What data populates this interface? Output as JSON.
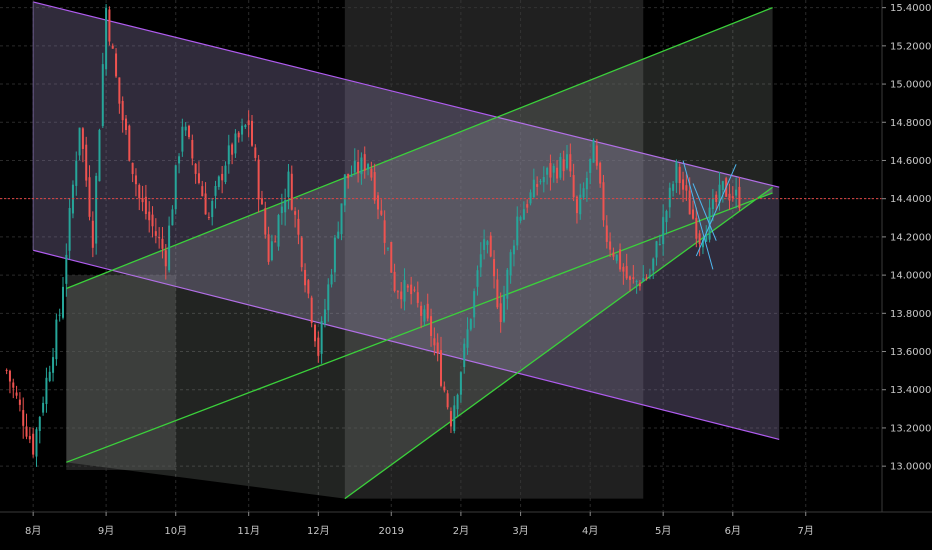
{
  "chart_data": {
    "type": "candlestick",
    "y_ticks": [
      "15.40000",
      "15.20000",
      "15.00000",
      "14.80000",
      "14.60000",
      "14.40000",
      "14.20000",
      "14.00000",
      "13.80000",
      "13.60000",
      "13.40000",
      "13.20000",
      "13.00000"
    ],
    "y_values": [
      15.4,
      15.2,
      15.0,
      14.8,
      14.6,
      14.4,
      14.2,
      14.0,
      13.8,
      13.6,
      13.4,
      13.2,
      13.0
    ],
    "ylim": [
      12.76,
      15.44
    ],
    "x_ticks": [
      "8月",
      "9月",
      "10月",
      "11月",
      "12月",
      "2019",
      "2月",
      "3月",
      "4月",
      "5月",
      "6月",
      "7月"
    ],
    "x_tick_indices": [
      0,
      22,
      43,
      65,
      86,
      108,
      129,
      147,
      168,
      190,
      211,
      233
    ],
    "x_range_index": [
      -10,
      256
    ],
    "current_price": 14.4,
    "key_closes": [
      {
        "index": -8,
        "close": 13.5
      },
      {
        "index": 0,
        "close": 13.1
      },
      {
        "index": 8,
        "close": 13.8
      },
      {
        "index": 14,
        "close": 14.8
      },
      {
        "index": 18,
        "close": 14.2
      },
      {
        "index": 22,
        "close": 15.4
      },
      {
        "index": 26,
        "close": 14.9
      },
      {
        "index": 32,
        "close": 14.4
      },
      {
        "index": 40,
        "close": 14.1
      },
      {
        "index": 45,
        "close": 14.8
      },
      {
        "index": 53,
        "close": 14.3
      },
      {
        "index": 58,
        "close": 14.6
      },
      {
        "index": 65,
        "close": 14.8
      },
      {
        "index": 71,
        "close": 14.1
      },
      {
        "index": 77,
        "close": 14.5
      },
      {
        "index": 86,
        "close": 13.6
      },
      {
        "index": 94,
        "close": 14.5
      },
      {
        "index": 101,
        "close": 14.6
      },
      {
        "index": 105,
        "close": 14.3
      },
      {
        "index": 109,
        "close": 13.95
      },
      {
        "index": 114,
        "close": 13.9
      },
      {
        "index": 120,
        "close": 13.7
      },
      {
        "index": 126,
        "close": 13.25
      },
      {
        "index": 130,
        "close": 13.6
      },
      {
        "index": 136,
        "close": 14.2
      },
      {
        "index": 141,
        "close": 13.8
      },
      {
        "index": 146,
        "close": 14.3
      },
      {
        "index": 153,
        "close": 14.5
      },
      {
        "index": 161,
        "close": 14.6
      },
      {
        "index": 164,
        "close": 14.3
      },
      {
        "index": 169,
        "close": 14.65
      },
      {
        "index": 173,
        "close": 14.2
      },
      {
        "index": 180,
        "close": 13.95
      },
      {
        "index": 186,
        "close": 14.0
      },
      {
        "index": 194,
        "close": 14.55
      },
      {
        "index": 201,
        "close": 14.2
      },
      {
        "index": 208,
        "close": 14.45
      },
      {
        "index": 213,
        "close": 14.4
      }
    ],
    "drawings": {
      "purple_channel": {
        "upper_start": [
          0,
          15.43
        ],
        "upper_end": [
          225,
          14.46
        ],
        "lower_start": [
          0,
          14.13
        ],
        "lower_end": [
          225,
          13.14
        ],
        "color": "#b05cf0"
      },
      "green_channel": {
        "lines": [
          [
            [
              10,
              13.93
            ],
            [
              223,
              15.4
            ]
          ],
          [
            [
              94,
              12.83
            ],
            [
              223,
              14.46
            ]
          ],
          [
            [
              10,
              13.02
            ],
            [
              223,
              14.43
            ]
          ]
        ],
        "color": "#3bd13b"
      },
      "gray_zones": [
        [
          94,
          12.83,
          184,
          15.44
        ],
        [
          10,
          12.98,
          43,
          14.0
        ]
      ],
      "cyan_pattern_color": "#4fb8f0"
    },
    "colors": {
      "up": "#26a69a",
      "down": "#ef5350",
      "current_line": "#e04444",
      "grid": "#2a2a2a"
    }
  }
}
